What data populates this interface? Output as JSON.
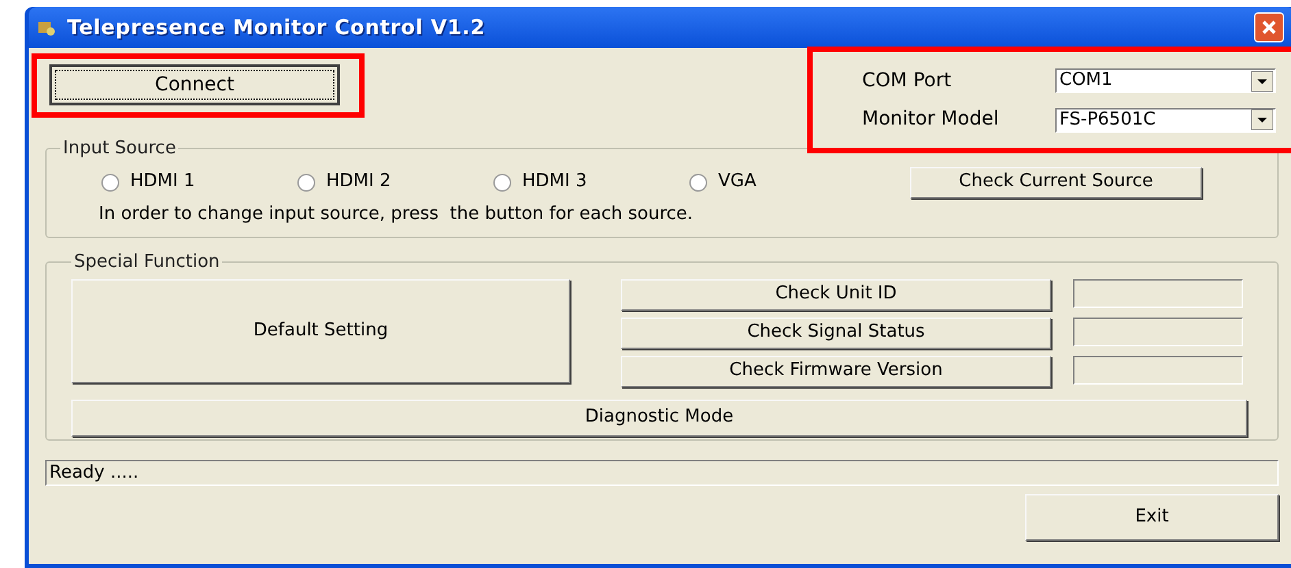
{
  "window": {
    "title": "Telepresence Monitor Control V1.2"
  },
  "connect_button": "Connect",
  "settings": [
    {
      "label": "COM Port",
      "value": "COM1"
    },
    {
      "label": "Monitor Model",
      "value": "FS-P6501C"
    }
  ],
  "input_source": {
    "title": "Input Source",
    "options": [
      {
        "label": "HDMI 1",
        "selected": false
      },
      {
        "label": "HDMI 2",
        "selected": false
      },
      {
        "label": "HDMI 3",
        "selected": false
      },
      {
        "label": "VGA",
        "selected": false
      }
    ],
    "check_button": "Check Current Source",
    "hint": "In order to change input source, press  the button for each source."
  },
  "special_function": {
    "title": "Special Function",
    "default_button": "Default Setting",
    "checks": [
      "Check Unit ID",
      "Check Signal Status",
      "Check Firmware Version"
    ],
    "diagnostic_button": "Diagnostic Mode"
  },
  "status_bar": "Ready .....",
  "exit_button": "Exit"
}
